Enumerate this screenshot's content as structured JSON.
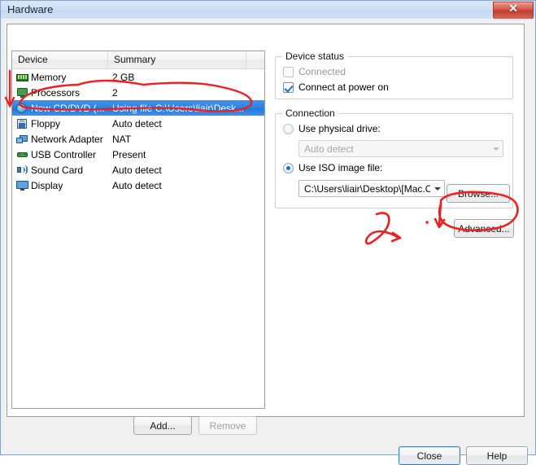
{
  "window": {
    "title": "Hardware",
    "close_icon": "close-x-icon"
  },
  "device_list": {
    "columns": [
      "Device",
      "Summary",
      ""
    ],
    "rows": [
      {
        "icon": "memory-icon",
        "device": "Memory",
        "summary": "2 GB",
        "selected": false
      },
      {
        "icon": "processors-icon",
        "device": "Processors",
        "summary": "2",
        "selected": false
      },
      {
        "icon": "cd-dvd-icon",
        "device": "New CD/DVD (...",
        "summary": "Using file C:\\Users\\liair\\Desk...",
        "selected": true
      },
      {
        "icon": "floppy-icon",
        "device": "Floppy",
        "summary": "Auto detect",
        "selected": false
      },
      {
        "icon": "network-adapter-icon",
        "device": "Network Adapter",
        "summary": "NAT",
        "selected": false
      },
      {
        "icon": "usb-controller-icon",
        "device": "USB Controller",
        "summary": "Present",
        "selected": false
      },
      {
        "icon": "sound-card-icon",
        "device": "Sound Card",
        "summary": "Auto detect",
        "selected": false
      },
      {
        "icon": "display-icon",
        "device": "Display",
        "summary": "Auto detect",
        "selected": false
      }
    ],
    "add_label": "Add...",
    "remove_label": "Remove"
  },
  "device_status": {
    "title": "Device status",
    "connected_label": "Connected",
    "connected_checked": false,
    "connected_enabled": false,
    "connect_at_power_on_label": "Connect at power on",
    "connect_at_power_on_checked": true
  },
  "connection": {
    "title": "Connection",
    "use_physical_drive_label": "Use physical drive:",
    "use_physical_drive_selected": false,
    "physical_drive_value": "Auto detect",
    "physical_drive_enabled": false,
    "use_iso_image_label": "Use ISO image file:",
    "use_iso_image_selected": true,
    "iso_path_value": "C:\\Users\\liair\\Desktop\\[Mac.OS.",
    "browse_label": "Browse...",
    "advanced_label": "Advanced..."
  },
  "footer": {
    "close_label": "Close",
    "help_label": "Help"
  },
  "annotations": {
    "color": "#f41c1c",
    "marks": [
      "down-arrow-left-margin",
      "ellipse-around-selected-cd-row",
      "arrow-squiggle-center",
      "ellipse-around-advanced-button"
    ]
  }
}
